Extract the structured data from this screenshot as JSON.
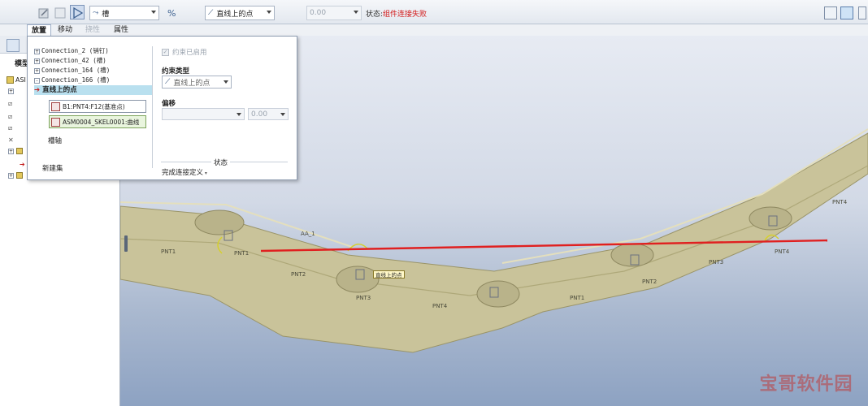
{
  "toolbar": {
    "constraint_combo": "槽",
    "constraint_type_combo": "直线上的点",
    "offset_value": "0.00",
    "status_label": "状态:",
    "status_value": "组件连接失败"
  },
  "tabs": [
    {
      "label": "放置",
      "state": "selected"
    },
    {
      "label": "移动",
      "state": "normal"
    },
    {
      "label": "挠性",
      "state": "disabled"
    },
    {
      "label": "属性",
      "state": "normal"
    }
  ],
  "model_tree": {
    "tab_label": "模型",
    "root_label": "ASI"
  },
  "placement": {
    "connections": [
      {
        "label": "Connection_2 (销钉)",
        "expander": "+"
      },
      {
        "label": "Connection_42 (槽)",
        "expander": "+"
      },
      {
        "label": "Connection_164 (槽)",
        "expander": "+"
      },
      {
        "label": "Connection_166 (槽)",
        "expander": "-"
      }
    ],
    "selected_constraint": "直线上的点",
    "reference_1": "B1:PNT4:F12(基准点)",
    "reference_2": "ASM0004_SKEL0001:曲线",
    "slot_axis": "槽轴",
    "new_set": "新建集",
    "constraint_enabled": "约束已启用",
    "constraint_type_label": "约束类型",
    "constraint_type_value": "直线上的点",
    "offset_label": "偏移",
    "offset_value": "0.00",
    "status_title": "状态",
    "status_text": "完成连接定义"
  },
  "viewport": {
    "point_tag": "直线上的点",
    "part_labels": [
      "PNT1",
      "PNT1",
      "PNT2",
      "PNT3",
      "PNT4",
      "PNT1",
      "PNT2",
      "PNT3",
      "PNT4",
      "PNT4",
      "AA_1"
    ],
    "watermark": "宝哥软件园",
    "highlight_line_color": "#e02020",
    "chain_color": "#c9c39a"
  }
}
